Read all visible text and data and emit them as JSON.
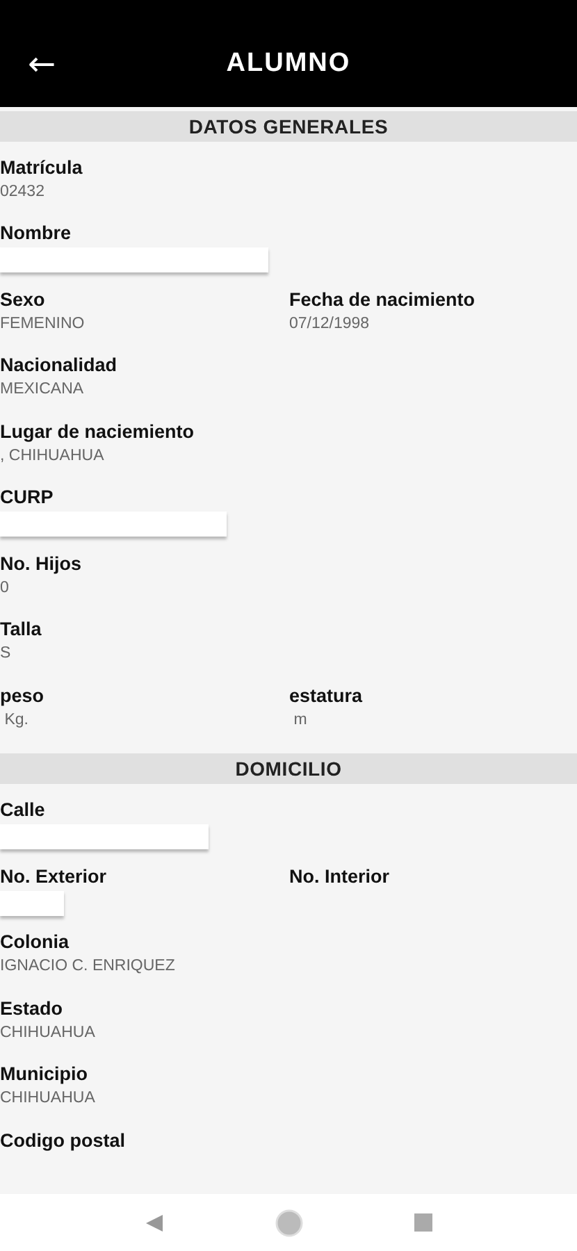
{
  "app_bar": {
    "back_icon": "←",
    "title": "ALUMNO"
  },
  "sections": [
    {
      "title": "DATOS GENERALES",
      "rows": [
        [
          {
            "label": "Matrícula",
            "kind": "text",
            "value": "02432"
          }
        ],
        [
          {
            "label": "Nombre",
            "kind": "blank"
          }
        ],
        [
          {
            "label": "Sexo",
            "kind": "text",
            "value": "FEMENINO"
          },
          {
            "label": "Fecha de nacimiento",
            "kind": "text",
            "value": "07/12/1998"
          }
        ],
        [
          {
            "label": "Nacionalidad",
            "kind": "text",
            "value": "MEXICANA"
          }
        ],
        [
          {
            "label": "Lugar de naciemiento",
            "kind": "text",
            "value": ", CHIHUAHUA"
          }
        ],
        [
          {
            "label": "CURP",
            "kind": "blank"
          }
        ],
        [
          {
            "label": "No. Hijos",
            "kind": "text",
            "value": "0"
          }
        ],
        [
          {
            "label": "Talla",
            "kind": "text",
            "value": "S"
          }
        ],
        [
          {
            "label": "peso",
            "kind": "text",
            "value": " Kg."
          },
          {
            "label": "estatura",
            "kind": "text",
            "value": " m"
          }
        ]
      ]
    },
    {
      "title": "DOMICILIO",
      "rows": [
        [
          {
            "label": "Calle",
            "kind": "blank"
          }
        ],
        [
          {
            "label": "No. Exterior",
            "kind": "blank"
          },
          {
            "label": "No. Interior",
            "kind": "empty"
          }
        ],
        [
          {
            "label": "Colonia",
            "kind": "text",
            "value": "IGNACIO C. ENRIQUEZ"
          }
        ],
        [
          {
            "label": "Estado",
            "kind": "text",
            "value": "CHIHUAHUA"
          }
        ],
        [
          {
            "label": "Municipio",
            "kind": "text",
            "value": "CHIHUAHUA"
          }
        ],
        [
          {
            "label": "Codigo postal",
            "kind": "empty"
          }
        ]
      ]
    }
  ]
}
